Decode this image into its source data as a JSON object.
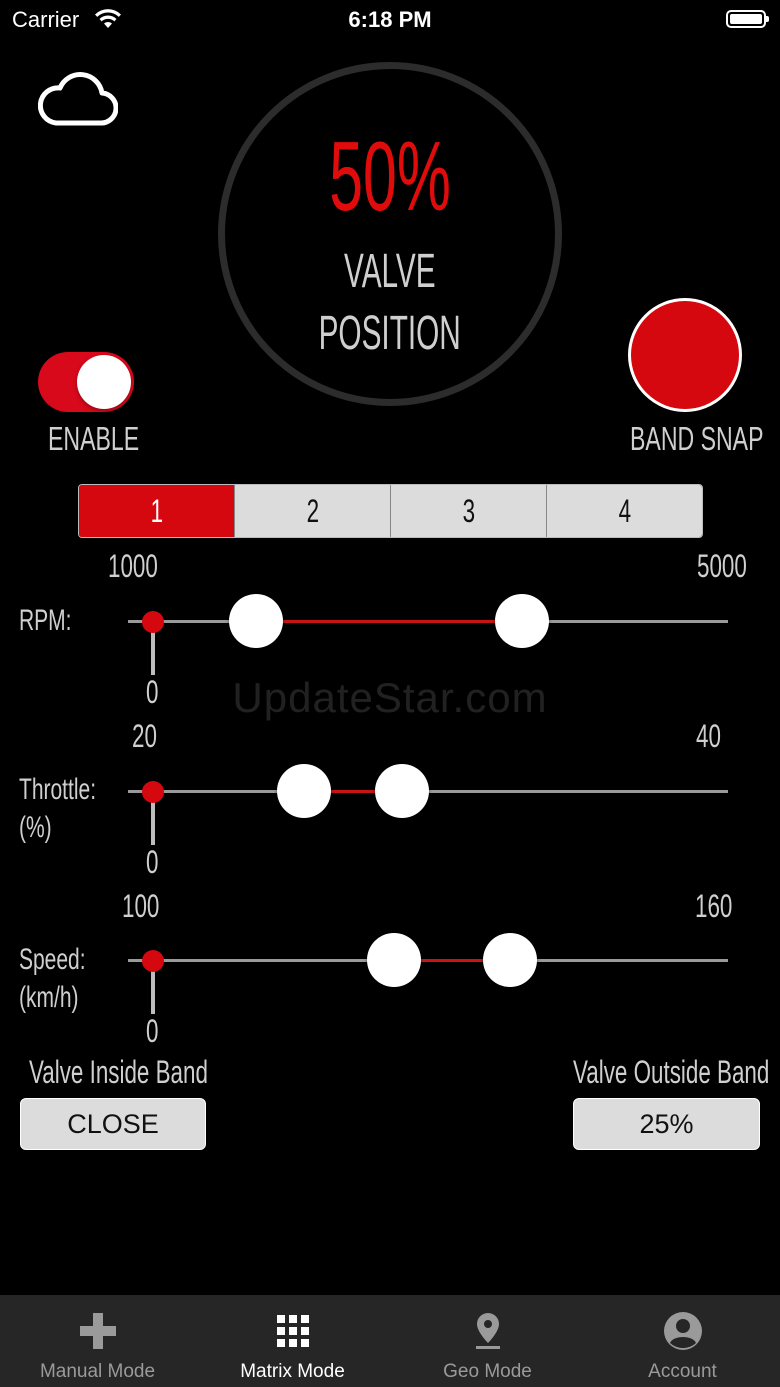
{
  "status_bar": {
    "carrier": "Carrier",
    "time": "6:18 PM"
  },
  "gauge": {
    "value": "50%",
    "line1": "VALVE",
    "line2": "POSITION",
    "accent": "#e00c0c"
  },
  "enable": {
    "label": "ENABLE",
    "on": true
  },
  "band_snap": {
    "label": "BAND SNAP",
    "color": "#d6080f"
  },
  "segments": {
    "items": [
      "1",
      "2",
      "3",
      "4"
    ],
    "selected": 0
  },
  "sliders": [
    {
      "label": "RPM:",
      "label2": "",
      "min": "1000",
      "max": "5000",
      "offset": "0",
      "low": 1550,
      "high": 3500
    },
    {
      "label": "Throttle:",
      "label2": "(%)",
      "min": "20",
      "max": "40",
      "offset": "0",
      "low": 24.5,
      "high": 28.1
    },
    {
      "label": "Speed:",
      "label2": "(km/h)",
      "min": "100",
      "max": "160",
      "offset": "0",
      "low": 123.5,
      "high": 136.2
    }
  ],
  "inside_band": {
    "label": "Valve Inside Band",
    "value": "CLOSE"
  },
  "outside_band": {
    "label": "Valve Outside Band",
    "value": "25%"
  },
  "tabs": [
    {
      "label": "Manual Mode",
      "icon": "gamepad-icon",
      "active": false
    },
    {
      "label": "Matrix Mode",
      "icon": "grid-icon",
      "active": true
    },
    {
      "label": "Geo Mode",
      "icon": "location-pin-icon",
      "active": false
    },
    {
      "label": "Account",
      "icon": "account-icon",
      "active": false
    }
  ],
  "watermark": "UpdateStar.com"
}
